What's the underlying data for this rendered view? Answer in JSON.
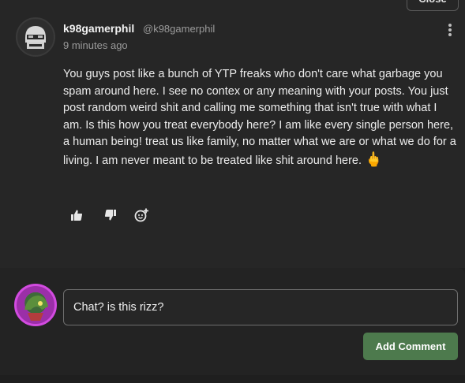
{
  "top_button": {
    "label": "Close"
  },
  "comment": {
    "username": "k98gamerphil",
    "handle": "@k98gamerphil",
    "timestamp": "9 minutes ago",
    "body": "You guys post like a bunch of YTP freaks who don't care what garbage you spam around here. I see no contex or any meaning with your posts. You just post random weird shit and calling me something that isn't true with what I am. Is this how you treat everybody here? I am like every single person here, a human being! treat us like family, no matter what we are or what we do for a living. I am never meant to be treated like shit around here.",
    "emoji": "🖕",
    "actions": {
      "like_icon": "thumbs-up-icon",
      "dislike_icon": "thumbs-down-icon",
      "react_icon": "add-reaction-icon"
    }
  },
  "composer": {
    "input_value": "Chat? is this rizz?",
    "submit_label": "Add Comment"
  },
  "colors": {
    "background": "#1f1f1f",
    "card": "#262626",
    "accent_button": "#4d7a4d",
    "avatar_ring": "#d24be0"
  }
}
